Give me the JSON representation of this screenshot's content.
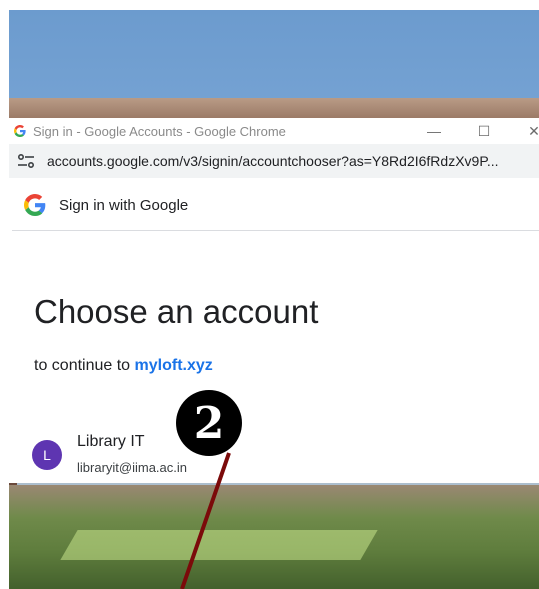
{
  "browser": {
    "title": "Sign in - Google Accounts - Google Chrome",
    "url": "accounts.google.com/v3/signin/accountchooser?as=Y8Rd2I6fRdzXv9P...",
    "controls": {
      "minimize": "—",
      "maximize": "☐",
      "close": "✕"
    }
  },
  "google": {
    "header": "Sign in with Google",
    "heading": "Choose an account",
    "continue_prefix": "to continue to ",
    "continue_site": "myloft.xyz"
  },
  "account": {
    "initial": "L",
    "name": "Library IT",
    "email": "libraryit@iima.ac.in"
  },
  "annotation": {
    "step": "❷",
    "arrow_color": "#7b0a0a"
  },
  "colors": {
    "link": "#1a73e8",
    "avatar": "#5e35b1"
  }
}
